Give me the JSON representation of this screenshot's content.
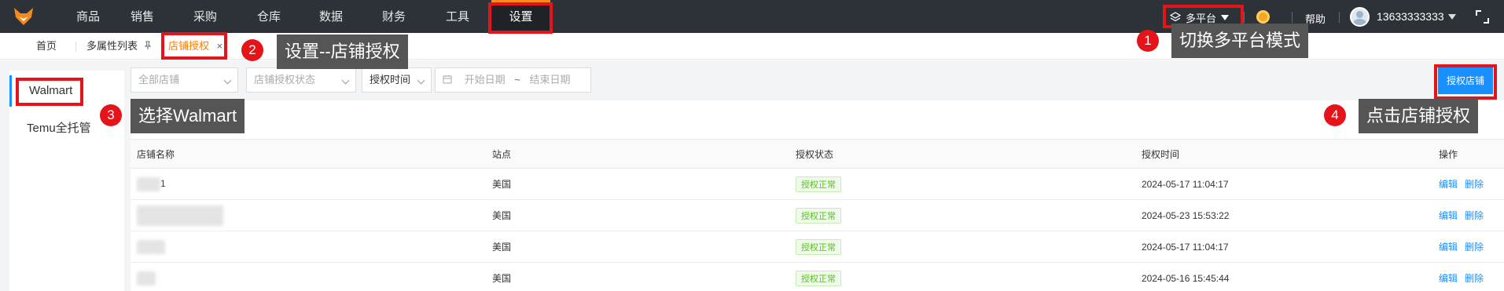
{
  "nav": {
    "items": [
      "商品",
      "销售",
      "采购",
      "仓库",
      "数据",
      "财务",
      "工具",
      "设置"
    ],
    "platform_label": "多平台",
    "help_label": "帮助",
    "username": "13633333333"
  },
  "tabs": {
    "home": "首页",
    "multi_attr": "多属性列表",
    "store_auth": "店铺授权"
  },
  "sidebar": {
    "items": [
      "Walmart",
      "Temu全托管"
    ]
  },
  "filters": {
    "all_stores": "全部店铺",
    "auth_status": "店铺授权状态",
    "auth_time": "授权时间",
    "date_start": "开始日期",
    "date_sep": "~",
    "date_end": "结束日期",
    "auth_button": "授权店铺"
  },
  "table": {
    "headers": [
      "店铺名称",
      "站点",
      "授权状态",
      "授权时间",
      "操作"
    ],
    "rows": [
      {
        "name_suffix": "1",
        "site": "美国",
        "status": "授权正常",
        "time": "2024-05-17 11:04:17"
      },
      {
        "name_suffix": "",
        "site": "美国",
        "status": "授权正常",
        "time": "2024-05-23 15:53:22"
      },
      {
        "name_suffix": "",
        "site": "美国",
        "status": "授权正常",
        "time": "2024-05-17 11:04:17"
      },
      {
        "name_suffix": "",
        "site": "美国",
        "status": "授权正常",
        "time": "2024-05-16 15:45:44"
      }
    ],
    "edit_label": "编辑",
    "delete_label": "删除"
  },
  "annotations": {
    "step1": {
      "num": "1",
      "text": "切换多平台模式"
    },
    "step2": {
      "num": "2",
      "text": "设置--店铺授权"
    },
    "step3": {
      "num": "3",
      "text": "选择Walmart"
    },
    "step4": {
      "num": "4",
      "text": "点击店铺授权"
    }
  },
  "colors": {
    "topbar": "#2d3238",
    "accent": "#1890ff",
    "highlight": "#e5141b",
    "active_tab": "#ff7d00",
    "status_ok": "#52c41a"
  }
}
